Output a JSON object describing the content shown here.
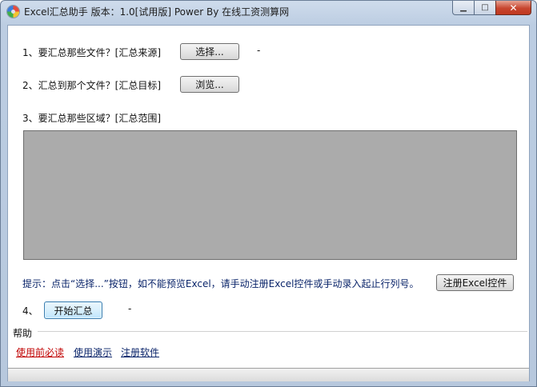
{
  "window": {
    "title": "Excel汇总助手 版本：1.0[试用版] Power By 在线工资测算网",
    "minimize_glyph": "▁",
    "maximize_glyph": "□",
    "close_glyph": "✕"
  },
  "step1": {
    "label": "1、要汇总那些文件？[汇总来源]",
    "button": "选择...",
    "value": "-"
  },
  "step2": {
    "label": "2、汇总到那个文件？[汇总目标]",
    "button": "浏览..."
  },
  "step3": {
    "label": "3、要汇总那些区域？[汇总范围]"
  },
  "hint": {
    "text": "提示：点击“选择...”按钮，如不能预览Excel，请手动注册Excel控件或手动录入起止行列号。",
    "register_button": "注册Excel控件"
  },
  "step4": {
    "label": "4、",
    "button": "开始汇总",
    "value": "-"
  },
  "help": {
    "title": "帮助",
    "links": [
      "使用前必读",
      "使用演示",
      "注册软件"
    ],
    "colors": {
      "first": "#c00000",
      "other": "#0a246a"
    }
  }
}
